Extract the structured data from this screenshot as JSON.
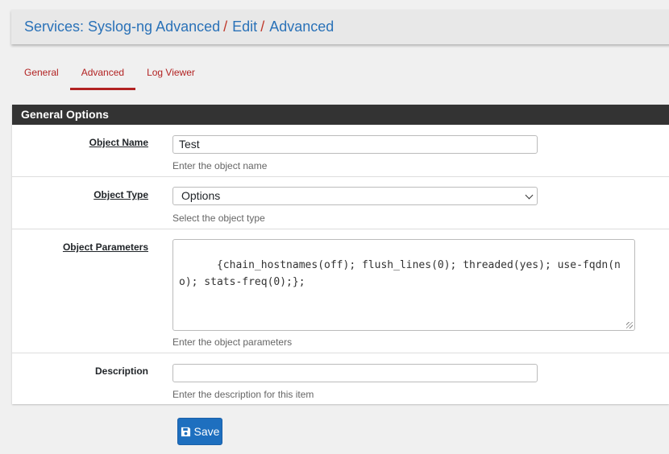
{
  "breadcrumb": {
    "items": [
      "Services: Syslog-ng Advanced",
      "Edit",
      "Advanced"
    ],
    "separator": "/"
  },
  "tabs": [
    {
      "label": "General",
      "active": false
    },
    {
      "label": "Advanced",
      "active": true
    },
    {
      "label": "Log Viewer",
      "active": false
    }
  ],
  "panel": {
    "title": "General Options",
    "fields": {
      "object_name": {
        "label": "Object Name",
        "value": "Test",
        "help": "Enter the object name"
      },
      "object_type": {
        "label": "Object Type",
        "value": "Options",
        "help": "Select the object type"
      },
      "object_parameters": {
        "label": "Object Parameters",
        "value": "{chain_hostnames(off); flush_lines(0); threaded(yes); use-fqdn(no); stats-freq(0);};",
        "help": "Enter the object parameters"
      },
      "description": {
        "label": "Description",
        "value": "",
        "help": "Enter the description for this item"
      }
    }
  },
  "save_button": {
    "label": "Save",
    "icon": "save-icon"
  },
  "colors": {
    "accent": "#b22222",
    "link": "#2a72b8",
    "primary": "#1e6fbf",
    "header": "#333333"
  }
}
